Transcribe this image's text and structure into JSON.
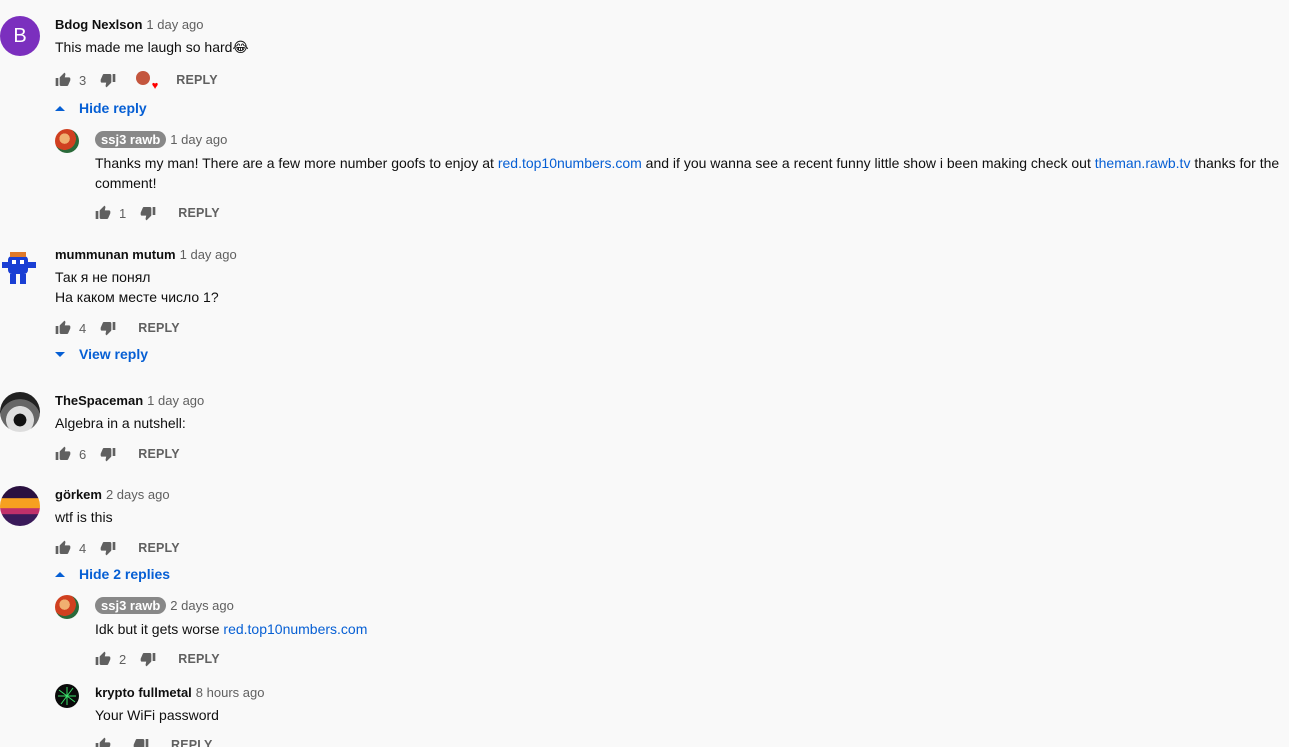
{
  "comments": [
    {
      "author": "Bdog Nexlson",
      "time": "1 day ago",
      "avatar_letter": "B",
      "avatar_color": "#7b2fbe",
      "text": "This made me laugh so hard😂",
      "likes": "3",
      "reply_label": "REPLY",
      "toggle_label": "Hide reply"
    },
    {
      "author": "ssj3 rawb",
      "time": "1 day ago",
      "text_parts": [
        "Thanks my man! There are a few more number goofs to enjoy at ",
        "red.top10numbers.com",
        " and if you wanna see a recent funny little show i been making check out ",
        "theman.rawb.tv",
        " thanks for the comment!"
      ],
      "likes": "1",
      "reply_label": "REPLY"
    },
    {
      "author": "mummunan mutum",
      "time": "1 day ago",
      "text_line1": "Так я не понял",
      "text_line2": "На каком месте число 1?",
      "likes": "4",
      "reply_label": "REPLY",
      "toggle_label": "View reply"
    },
    {
      "author": "TheSpaceman",
      "time": "1 day ago",
      "text": "Algebra in a nutshell:",
      "likes": "6",
      "reply_label": "REPLY"
    },
    {
      "author": "görkem",
      "time": "2 days ago",
      "text": "wtf is this",
      "likes": "4",
      "reply_label": "REPLY",
      "toggle_label": "Hide 2 replies"
    },
    {
      "author": "ssj3 rawb",
      "time": "2 days ago",
      "text_prefix": "Idk but it gets worse ",
      "text_link": "red.top10numbers.com",
      "likes": "2",
      "reply_label": "REPLY"
    },
    {
      "author": "krypto fullmetal",
      "time": "8 hours ago",
      "text": "Your WiFi password",
      "reply_label": "REPLY"
    }
  ],
  "colors": {
    "link": "#065fd4",
    "secondary_text": "#606060",
    "owner_chip": "#888888"
  },
  "icons": {
    "like": "thumbs-up-icon",
    "dislike": "thumbs-down-icon",
    "creator_heart": "creator-heart-icon",
    "toggle_up": "caret-up-icon",
    "toggle_down": "caret-down-icon"
  }
}
